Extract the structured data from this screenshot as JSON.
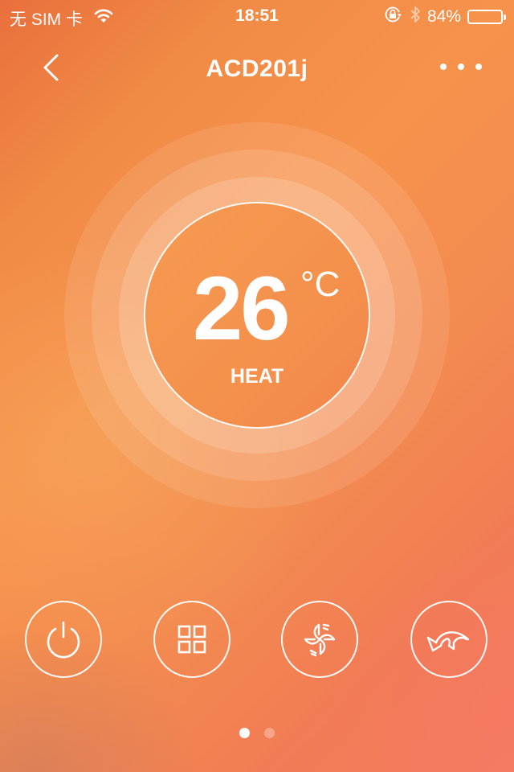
{
  "status_bar": {
    "carrier": "无 SIM 卡",
    "time": "18:51",
    "battery_percent_label": "84%",
    "battery_level": 0.84,
    "icons": [
      "wifi-icon",
      "rotation-lock-icon",
      "bluetooth-icon",
      "battery-icon"
    ]
  },
  "nav": {
    "title": "ACD201j",
    "back_icon": "chevron-left-icon",
    "more_icon": "more-horizontal-icon"
  },
  "thermostat": {
    "temperature": "26",
    "unit": "°C",
    "mode": "HEAT"
  },
  "controls": [
    {
      "name": "power",
      "icon": "power-icon"
    },
    {
      "name": "mode",
      "icon": "grid-icon"
    },
    {
      "name": "fan",
      "icon": "fan-icon"
    },
    {
      "name": "swing",
      "icon": "swing-arrow-icon"
    }
  ],
  "pager": {
    "total_pages": 2,
    "current_page": 1
  },
  "colors": {
    "background_top_left": "#e96f3c",
    "background_center": "#f7924c",
    "background_bottom_right": "#f47e60",
    "foreground": "#ffffff"
  }
}
